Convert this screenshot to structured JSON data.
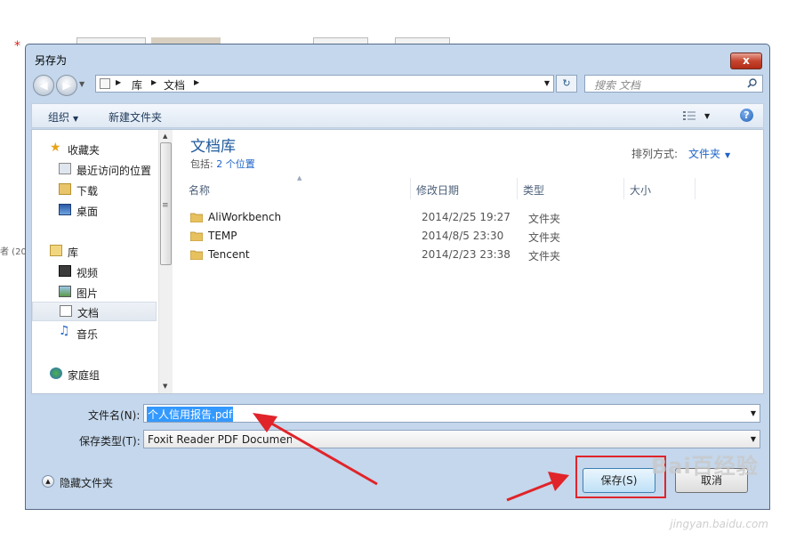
{
  "background": {
    "marker": "*",
    "side_text": "者 (20"
  },
  "window": {
    "title": "另存为",
    "close_label": "x"
  },
  "address_bar": {
    "segments": [
      "库",
      "文档"
    ]
  },
  "search": {
    "placeholder": "搜索 文档"
  },
  "toolbar": {
    "organize_label": "组织",
    "new_folder_label": "新建文件夹",
    "help_label": "?"
  },
  "nav_pane": {
    "items": [
      {
        "label": "收藏夹",
        "icon": "star-icon"
      },
      {
        "label": "最近访问的位置",
        "icon": "recent-places-icon"
      },
      {
        "label": "下载",
        "icon": "downloads-icon"
      },
      {
        "label": "桌面",
        "icon": "desktop-icon"
      },
      {
        "label": "库",
        "icon": "libraries-icon"
      },
      {
        "label": "视频",
        "icon": "videos-icon"
      },
      {
        "label": "图片",
        "icon": "pictures-icon"
      },
      {
        "label": "文档",
        "icon": "documents-icon",
        "selected": true
      },
      {
        "label": "音乐",
        "icon": "music-icon"
      },
      {
        "label": "家庭组",
        "icon": "homegroup-icon"
      }
    ]
  },
  "library": {
    "title": "文档库",
    "includes_prefix": "包括: ",
    "includes_link": "2 个位置",
    "arrange_label": "排列方式:",
    "arrange_value": "文件夹"
  },
  "columns": {
    "name": "名称",
    "date": "修改日期",
    "type": "类型",
    "size": "大小"
  },
  "files": [
    {
      "name": "AliWorkbench",
      "date": "2014/2/25 19:27",
      "type": "文件夹"
    },
    {
      "name": "TEMP",
      "date": "2014/8/5 23:30",
      "type": "文件夹"
    },
    {
      "name": "Tencent",
      "date": "2014/2/23 23:38",
      "type": "文件夹"
    }
  ],
  "form": {
    "filename_label": "文件名(N):",
    "filename_value": "个人信用报告.pdf",
    "filetype_label": "保存类型(T):",
    "filetype_value": "Foxit Reader PDF Document"
  },
  "footer": {
    "hide_folders_label": "隐藏文件夹",
    "save_label": "保存(S)",
    "cancel_label": "取消"
  },
  "watermark": {
    "text": "jingyan.baidu.com",
    "logo_text": "Bai百经验"
  },
  "colors": {
    "annotation_red": "#e0242a",
    "link_blue": "#1e64c8",
    "title_green_blue": "#1e5a9c"
  }
}
